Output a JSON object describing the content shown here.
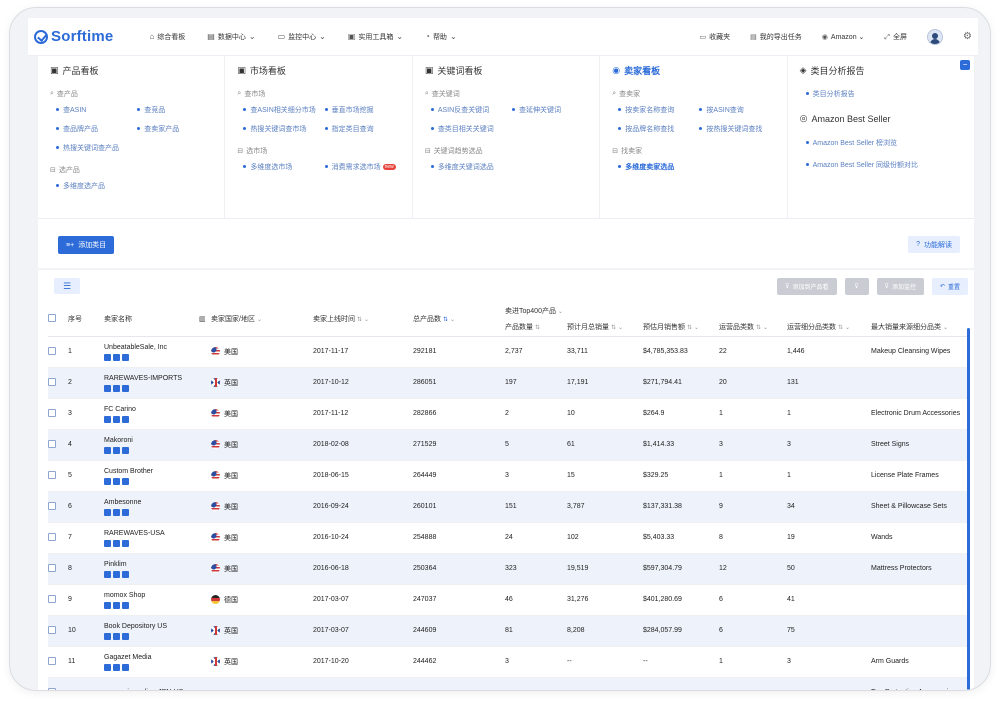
{
  "topbar": {
    "logo": "Sorftime",
    "nav": [
      {
        "label": "综合看板",
        "icon": "home-icon",
        "dropdown": false
      },
      {
        "label": "数据中心",
        "icon": "data-icon",
        "dropdown": true
      },
      {
        "label": "监控中心",
        "icon": "monitor-icon",
        "dropdown": true
      },
      {
        "label": "实用工具箱",
        "icon": "toolbox-icon",
        "dropdown": true
      },
      {
        "label": "帮助",
        "icon": "help-icon",
        "dropdown": true
      }
    ],
    "favorites": "收藏夹",
    "export_tasks": "我的导出任务",
    "marketplace": "Amazon",
    "fullscreen": "全屏"
  },
  "panel": {
    "product": {
      "title": "产品看板",
      "sections": [
        {
          "title": "查产品",
          "links": [
            "查ASIN",
            "查竞品",
            "查品牌产品",
            "查卖家产品",
            "热搜关键词查产品"
          ]
        },
        {
          "title": "选产品",
          "links": [
            "多维度选产品"
          ]
        }
      ]
    },
    "market": {
      "title": "市场看板",
      "sections": [
        {
          "title": "查市场",
          "links": [
            "查ASIN相关细分市场",
            "垂直市场挖掘",
            "热搜关键词查市场",
            "指定类目查询"
          ]
        },
        {
          "title": "选市场",
          "links": [
            "多维度选市场",
            "消费需求选市场"
          ]
        }
      ],
      "new_badge": "new"
    },
    "keyword": {
      "title": "关键词看板",
      "sections": [
        {
          "title": "查关键词",
          "links": [
            "ASIN反查关键词",
            "查延伸关键词",
            "查类目相关关键词"
          ]
        },
        {
          "title": "关键词趋势选品",
          "links": [
            "多维度关键词选品"
          ]
        }
      ]
    },
    "seller": {
      "title": "卖家看板",
      "sections": [
        {
          "title": "查卖家",
          "links": [
            "按卖家名称查询",
            "按ASIN查询",
            "按品牌名称查找",
            "按热搜关键词查找"
          ]
        },
        {
          "title": "找卖家",
          "links": [
            "多维度卖家选品"
          ]
        }
      ]
    },
    "category": {
      "title": "类目分析报告",
      "links": [
        "类目分析报告"
      ],
      "best_title": "Amazon Best Seller",
      "best_links": [
        "Amazon Best Seller 榜浏览",
        "Amazon Best Seller 同级份额对比"
      ]
    }
  },
  "toolbar": {
    "add_category": "添加类目",
    "func_explain": "功能解读",
    "add_to_product_pool": "添加到产品看",
    "add_monitor": "添加监控",
    "reset": "重置"
  },
  "table": {
    "headers": {
      "index": "序号",
      "name": "卖家名称",
      "country": "卖家国家/地区",
      "online": "卖家上线时间",
      "total": "总产品数",
      "group": "卖进Top400产品",
      "count": "产品数量",
      "monthly_sales": "预计月总销量",
      "monthly_revenue": "预估月销售额",
      "ops_cat": "运营品类数",
      "ops_sub": "运营细分品类数",
      "max_cat": "最大销量来源细分品类"
    },
    "rows": [
      {
        "idx": "1",
        "name": "UnbeatableSale, Inc",
        "country": "美国",
        "flag": "us",
        "date": "2017-11-17",
        "total": "292181",
        "count": "2,737",
        "sales": "33,711",
        "revenue": "$4,785,353.83",
        "ops": "22",
        "sub": "1,446",
        "cat": "Makeup Cleansing Wipes"
      },
      {
        "idx": "2",
        "name": "RAREWAVES-IMPORTS",
        "country": "英国",
        "flag": "gb",
        "date": "2017-10-12",
        "total": "286051",
        "count": "197",
        "sales": "17,191",
        "revenue": "$271,794.41",
        "ops": "20",
        "sub": "131",
        "cat": ""
      },
      {
        "idx": "3",
        "name": "FC Carino",
        "country": "美国",
        "flag": "us",
        "date": "2017-11-12",
        "total": "282866",
        "count": "2",
        "sales": "10",
        "revenue": "$264.9",
        "ops": "1",
        "sub": "1",
        "cat": "Electronic Drum Accessories"
      },
      {
        "idx": "4",
        "name": "Makoroni",
        "country": "美国",
        "flag": "us",
        "date": "2018-02-08",
        "total": "271529",
        "count": "5",
        "sales": "61",
        "revenue": "$1,414.33",
        "ops": "3",
        "sub": "3",
        "cat": "Street Signs"
      },
      {
        "idx": "5",
        "name": "Custom Brother",
        "country": "美国",
        "flag": "us",
        "date": "2018-06-15",
        "total": "264449",
        "count": "3",
        "sales": "15",
        "revenue": "$329.25",
        "ops": "1",
        "sub": "1",
        "cat": "License Plate Frames"
      },
      {
        "idx": "6",
        "name": "Ambesonne",
        "country": "美国",
        "flag": "us",
        "date": "2016-09-24",
        "total": "260101",
        "count": "151",
        "sales": "3,787",
        "revenue": "$137,331.38",
        "ops": "9",
        "sub": "34",
        "cat": "Sheet & Pillowcase Sets"
      },
      {
        "idx": "7",
        "name": "RAREWAVES-USA",
        "country": "美国",
        "flag": "us",
        "date": "2016-10-24",
        "total": "254888",
        "count": "24",
        "sales": "102",
        "revenue": "$5,403.33",
        "ops": "8",
        "sub": "19",
        "cat": "Wands"
      },
      {
        "idx": "8",
        "name": "Pinklim",
        "country": "美国",
        "flag": "us",
        "date": "2016-06-18",
        "total": "250364",
        "count": "323",
        "sales": "19,519",
        "revenue": "$597,304.79",
        "ops": "12",
        "sub": "50",
        "cat": "Mattress Protectors"
      },
      {
        "idx": "9",
        "name": "momox Shop",
        "country": "德国",
        "flag": "de",
        "date": "2017-03-07",
        "total": "247037",
        "count": "46",
        "sales": "31,276",
        "revenue": "$401,280.69",
        "ops": "6",
        "sub": "41",
        "cat": ""
      },
      {
        "idx": "10",
        "name": "Book Depository US",
        "country": "英国",
        "flag": "gb",
        "date": "2017-03-07",
        "total": "244609",
        "count": "81",
        "sales": "8,208",
        "revenue": "$284,057.99",
        "ops": "6",
        "sub": "75",
        "cat": ""
      },
      {
        "idx": "11",
        "name": "Gagazet Media",
        "country": "英国",
        "flag": "gb",
        "date": "2017-10-20",
        "total": "244462",
        "count": "3",
        "sales": "--",
        "revenue": "--",
        "ops": "1",
        "sub": "3",
        "cat": "Arm Guards"
      },
      {
        "idx": "",
        "name": "samurai_media - JPN-US",
        "country": "",
        "flag": "",
        "date": "",
        "total": "",
        "count": "",
        "sales": "",
        "revenue": "",
        "ops": "",
        "sub": "",
        "cat": "Eye Protection Accessories"
      }
    ]
  }
}
